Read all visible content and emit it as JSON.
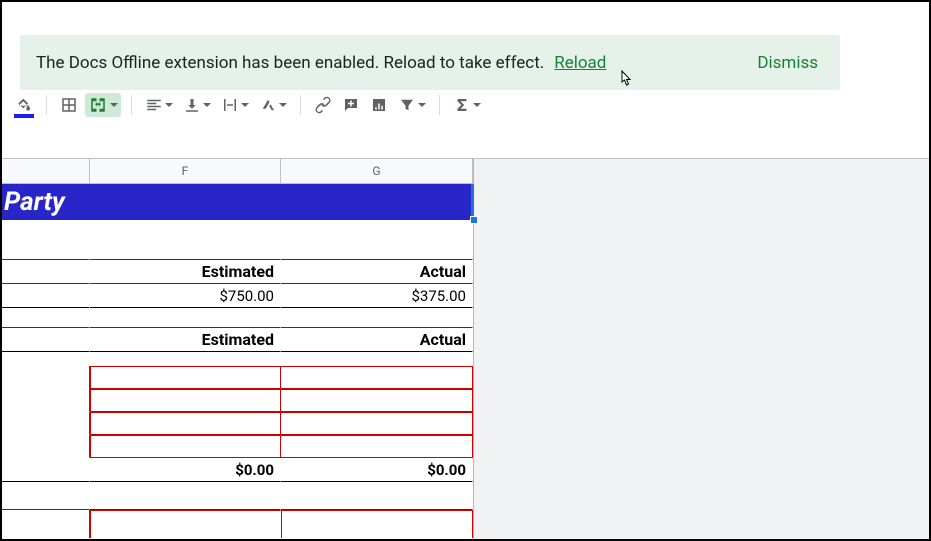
{
  "notification": {
    "message": "The Docs Offline extension has been enabled. Reload to take effect.",
    "reload_label": "Reload",
    "dismiss_label": "Dismiss"
  },
  "toolbar": {
    "icons": {
      "paint_format": "paint-format",
      "insert_chart": "insert-chart",
      "cell_format": "cell-format",
      "align_h": "horizontal-align",
      "align_v": "vertical-align",
      "wrap": "text-wrap",
      "rotate": "text-rotate",
      "link": "insert-link",
      "comment": "insert-comment",
      "chart": "insert-chart-small",
      "filter": "filter",
      "functions": "functions-sigma"
    }
  },
  "columns": {
    "F": "F",
    "G": "G"
  },
  "sheet": {
    "title_cell": "Party",
    "section1": {
      "header_estimated": "Estimated",
      "header_actual": "Actual",
      "value_estimated": "$750.00",
      "value_actual": "$375.00"
    },
    "section2": {
      "header_estimated": "Estimated",
      "header_actual": "Actual",
      "total_estimated": "$0.00",
      "total_actual": "$0.00"
    }
  }
}
